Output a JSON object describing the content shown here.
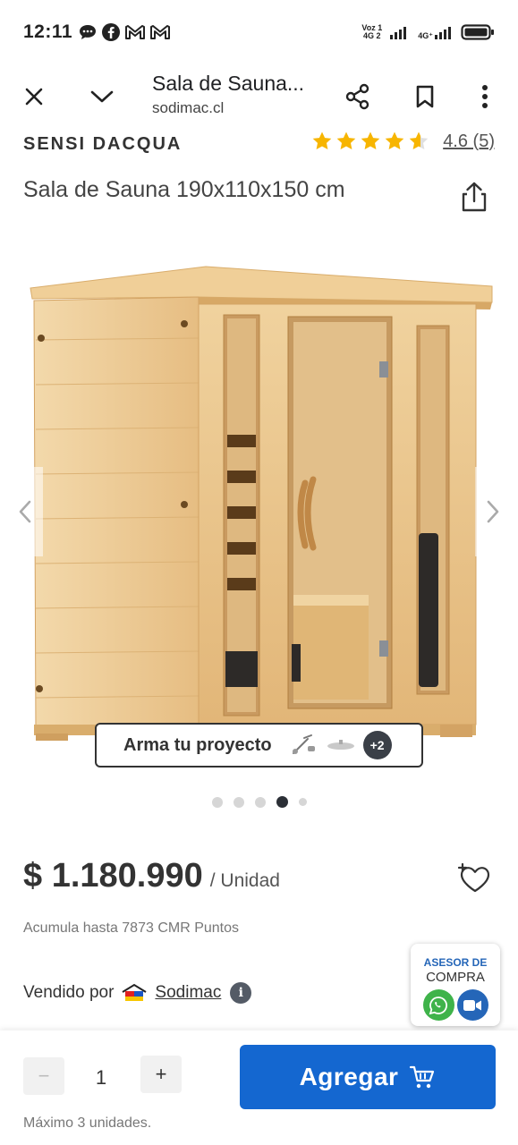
{
  "status_bar": {
    "time": "12:11",
    "left_icons": [
      "chat-bubble-icon",
      "facebook-icon",
      "gmail-icon",
      "gmail-icon"
    ],
    "volte_line1": "Voz 1",
    "volte_line2": "4G  2",
    "network": "4G⁺"
  },
  "tab_bar": {
    "title": "Sala de Sauna...",
    "url": "sodimac.cl"
  },
  "product": {
    "brand": "SENSI DACQUA",
    "rating_value": 4.6,
    "rating_text": "4.6 (5)",
    "title": "Sala de Sauna 190x110x150 cm"
  },
  "gallery": {
    "project_button_label": "Arma tu proyecto",
    "project_more": "+2",
    "image_count": 5,
    "active_index": 3
  },
  "price": {
    "amount": "$ 1.180.990",
    "unit": "/ Unidad",
    "points": "Acumula hasta 7873 CMR Puntos"
  },
  "seller": {
    "label": "Vendido por",
    "name": "Sodimac"
  },
  "advisor": {
    "line1": "ASESOR DE",
    "line2": "COMPRA"
  },
  "cart": {
    "quantity": "1",
    "minus": "−",
    "plus": "+",
    "add_label": "Agregar",
    "max_units": "Máximo 3 unidades."
  },
  "colors": {
    "primary_blue": "#1467d0",
    "star_yellow": "#f7b500",
    "whatsapp_green": "#3fb34a",
    "advisor_blue": "#2566b8"
  }
}
